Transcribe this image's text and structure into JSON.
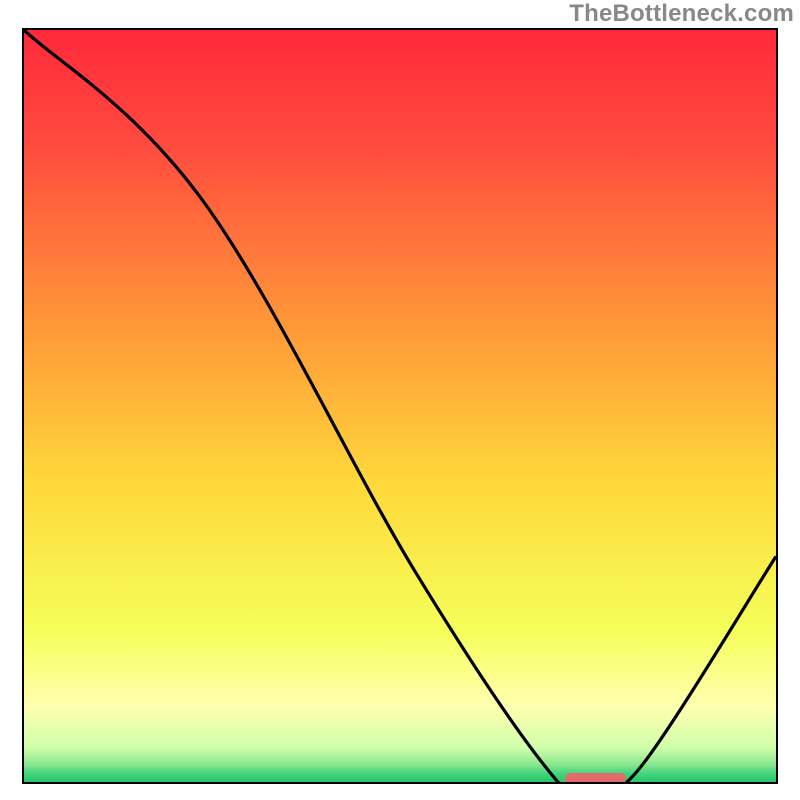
{
  "watermark": "TheBottleneck.com",
  "chart_data": {
    "type": "line",
    "title": "",
    "xlabel": "",
    "ylabel": "",
    "xlim": [
      0,
      100
    ],
    "ylim": [
      0,
      100
    ],
    "background": "gradient-rainbow-vertical",
    "x": [
      0,
      24,
      52,
      71,
      76,
      82,
      100
    ],
    "values": [
      100,
      77,
      28,
      0,
      0,
      2,
      30
    ],
    "marker": {
      "x_range": [
        72,
        80
      ],
      "y": 0,
      "color": "#e26a6a",
      "thickness_pct": 1.2
    }
  },
  "colors": {
    "gradient_stops": [
      {
        "offset": 0.0,
        "hex": "#ff2a3a"
      },
      {
        "offset": 0.15,
        "hex": "#ff4a3e"
      },
      {
        "offset": 0.4,
        "hex": "#ff9a38"
      },
      {
        "offset": 0.6,
        "hex": "#ffd83a"
      },
      {
        "offset": 0.8,
        "hex": "#f5ff5a"
      },
      {
        "offset": 0.9,
        "hex": "#ffffb0"
      },
      {
        "offset": 0.955,
        "hex": "#cfffaa"
      },
      {
        "offset": 0.975,
        "hex": "#8fe891"
      },
      {
        "offset": 0.99,
        "hex": "#3fd37a"
      },
      {
        "offset": 1.0,
        "hex": "#28c46a"
      }
    ],
    "curve": "#000000",
    "marker": "#e26a6a"
  }
}
